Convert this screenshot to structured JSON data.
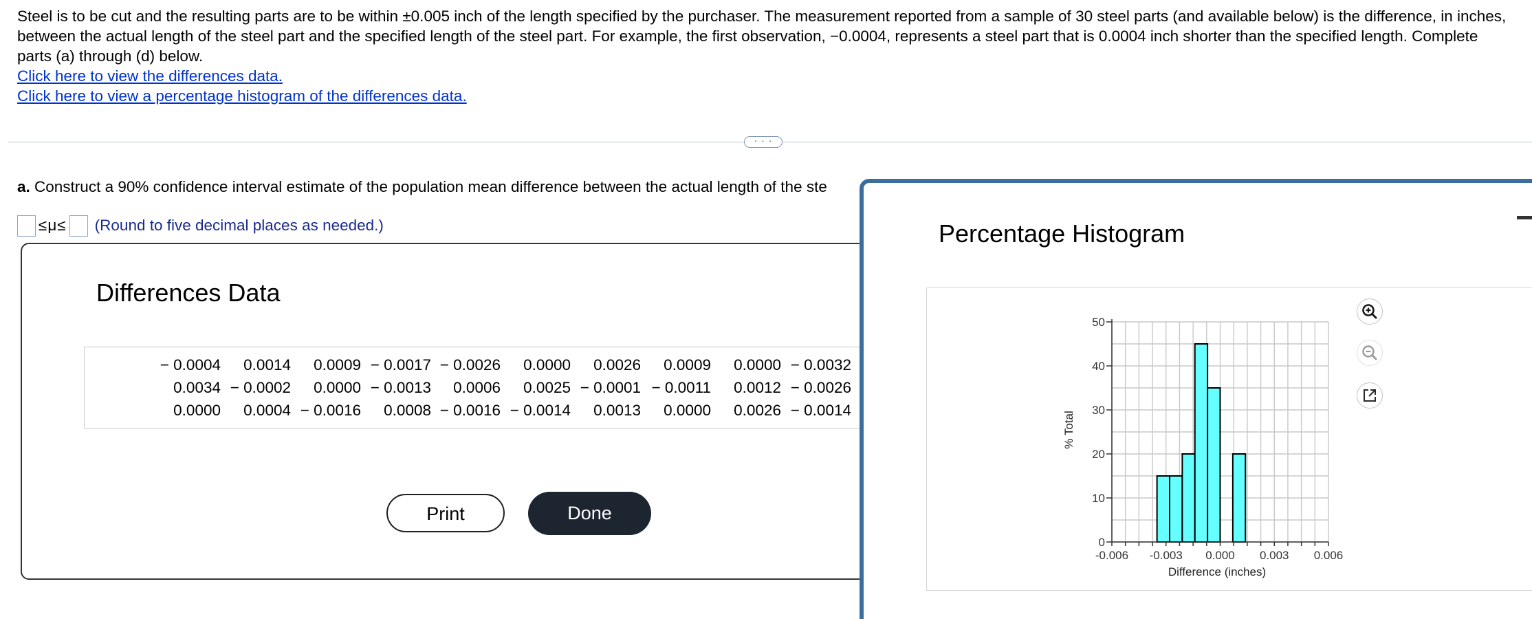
{
  "problem": {
    "text": "Steel is to be cut and the resulting parts are to be within ±0.005 inch of the length specified by the purchaser. The measurement reported from a sample of 30 steel parts (and available below) is the difference, in inches, between the actual length of the steel part and the specified length of the steel part. For example, the first observation, −0.0004, represents a steel part that is 0.0004 inch shorter than the specified length. Complete parts (a) through (d) below.",
    "link_data": "Click here to view the differences data.",
    "link_histogram": "Click here to view a percentage histogram of the differences data."
  },
  "divider": {
    "ellipsis": "· · ·"
  },
  "part_a": {
    "label": "a.",
    "text": "Construct a 90% confidence interval estimate of the population mean difference between the actual length of the ste",
    "answer_symbols": "≤μ≤",
    "round_note": "(Round to five decimal places as needed.)"
  },
  "differences_panel": {
    "title": "Differences Data",
    "rows": [
      [
        "− 0.0004",
        "0.0014",
        "0.0009",
        "− 0.0017",
        "− 0.0026",
        "0.0000",
        "0.0026",
        "0.0009",
        "0.0000",
        "− 0.0032"
      ],
      [
        "0.0034",
        "− 0.0002",
        "0.0000",
        "− 0.0013",
        "0.0006",
        "0.0025",
        "− 0.0001",
        "− 0.0011",
        "0.0012",
        "− 0.0026"
      ],
      [
        "0.0000",
        "0.0004",
        "− 0.0016",
        "0.0008",
        "− 0.0016",
        "− 0.0014",
        "0.0013",
        "0.0000",
        "0.0026",
        "− 0.0014"
      ]
    ],
    "print_label": "Print",
    "done_label": "Done"
  },
  "histogram_panel": {
    "title": "Percentage Histogram",
    "icons": [
      "zoom-in-icon",
      "zoom-out-icon",
      "pop-out-icon"
    ]
  },
  "chart_data": {
    "type": "bar",
    "title": "",
    "xlabel": "Difference (inches)",
    "ylabel": "% Total",
    "xlim": [
      -0.006,
      0.006
    ],
    "ylim": [
      0,
      50
    ],
    "x_ticks": [
      "-0.006",
      "-0.003",
      "0.000",
      "0.003",
      "0.006"
    ],
    "y_ticks": [
      "0",
      "10",
      "20",
      "30",
      "40",
      "50"
    ],
    "bin_width": 0.0007,
    "bins": [
      {
        "start": -0.0035,
        "end": -0.0028,
        "value": 15
      },
      {
        "start": -0.0028,
        "end": -0.0021,
        "value": 15
      },
      {
        "start": -0.0021,
        "end": -0.0014,
        "value": 20
      },
      {
        "start": -0.0014,
        "end": -0.0007,
        "value": 45
      },
      {
        "start": -0.0007,
        "end": 0.0,
        "value": 35
      },
      {
        "start": 0.0007,
        "end": 0.0014,
        "value": 20
      }
    ],
    "grid": true,
    "bar_color": "#66ffff"
  }
}
